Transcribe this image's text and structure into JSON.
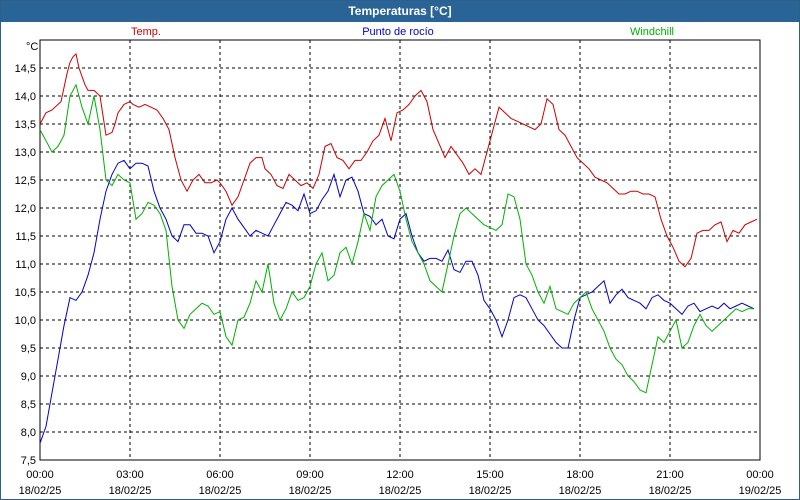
{
  "window": {
    "title": "Temperaturas [°C]"
  },
  "chart_data": {
    "type": "line",
    "title": "Temperaturas [°C]",
    "ylabel": "°C",
    "ylim": [
      7.5,
      15.0
    ],
    "grid": true,
    "legend": "top",
    "y_ticks": [
      "7,5",
      "8,0",
      "8,5",
      "9,0",
      "9,5",
      "10,0",
      "10,5",
      "11,0",
      "11,5",
      "12,0",
      "12,5",
      "13,0",
      "13,5",
      "14,0",
      "14,5"
    ],
    "x_ticks": [
      {
        "time": "00:00",
        "date": "18/02/25"
      },
      {
        "time": "03:00",
        "date": "18/02/25"
      },
      {
        "time": "06:00",
        "date": "18/02/25"
      },
      {
        "time": "09:00",
        "date": "18/02/25"
      },
      {
        "time": "12:00",
        "date": "18/02/25"
      },
      {
        "time": "15:00",
        "date": "18/02/25"
      },
      {
        "time": "18:00",
        "date": "18/02/25"
      },
      {
        "time": "21:00",
        "date": "18/02/25"
      },
      {
        "time": "00:00",
        "date": "19/02/25"
      }
    ],
    "x_range_hours": [
      0,
      24
    ],
    "series": [
      {
        "name": "Temp.",
        "color": "#cc0000",
        "x": [
          0,
          0.2,
          0.4,
          0.7,
          0.9,
          1.0,
          1.1,
          1.2,
          1.3,
          1.4,
          1.5,
          1.6,
          1.8,
          2.0,
          2.2,
          2.4,
          2.5,
          2.6,
          2.8,
          3.0,
          3.1,
          3.3,
          3.5,
          3.7,
          3.9,
          4.1,
          4.3,
          4.5,
          4.7,
          4.9,
          5.1,
          5.3,
          5.5,
          5.7,
          5.9,
          6.0,
          6.2,
          6.4,
          6.6,
          6.8,
          7.0,
          7.2,
          7.4,
          7.5,
          7.7,
          7.9,
          8.1,
          8.3,
          8.5,
          8.7,
          8.9,
          9.1,
          9.3,
          9.5,
          9.7,
          9.9,
          10.1,
          10.3,
          10.5,
          10.7,
          10.9,
          11.1,
          11.3,
          11.5,
          11.7,
          11.9,
          12.1,
          12.3,
          12.5,
          12.7,
          12.9,
          13.1,
          13.3,
          13.5,
          13.7,
          13.9,
          14.1,
          14.3,
          14.5,
          14.7,
          14.9,
          15.1,
          15.3,
          15.5,
          15.7,
          15.9,
          16.1,
          16.3,
          16.5,
          16.7,
          16.9,
          17.1,
          17.3,
          17.5,
          17.7,
          17.9,
          18.1,
          18.3,
          18.5,
          18.7,
          18.9,
          19.1,
          19.3,
          19.5,
          19.7,
          19.9,
          20.1,
          20.3,
          20.5,
          20.7,
          20.9,
          21.1,
          21.3,
          21.5,
          21.7,
          21.9,
          22.1,
          22.3,
          22.5,
          22.7,
          22.9,
          23.1,
          23.3,
          23.5,
          23.7,
          23.9
        ],
        "values": [
          13.5,
          13.7,
          13.75,
          13.9,
          14.4,
          14.6,
          14.7,
          14.75,
          14.5,
          14.35,
          14.2,
          14.1,
          14.1,
          14.0,
          13.3,
          13.35,
          13.5,
          13.7,
          13.85,
          13.9,
          13.85,
          13.8,
          13.85,
          13.8,
          13.75,
          13.6,
          13.4,
          12.9,
          12.5,
          12.3,
          12.5,
          12.6,
          12.45,
          12.45,
          12.5,
          12.45,
          12.3,
          12.05,
          12.2,
          12.5,
          12.8,
          12.9,
          12.9,
          12.7,
          12.6,
          12.4,
          12.35,
          12.6,
          12.5,
          12.4,
          12.45,
          12.35,
          12.6,
          13.1,
          13.15,
          12.9,
          12.85,
          12.7,
          12.85,
          12.85,
          13.0,
          13.2,
          13.3,
          13.6,
          13.2,
          13.7,
          13.75,
          13.85,
          14.0,
          14.1,
          13.9,
          13.4,
          13.15,
          12.9,
          13.1,
          12.95,
          12.8,
          12.6,
          12.7,
          12.6,
          13.0,
          13.4,
          13.8,
          13.7,
          13.6,
          13.55,
          13.5,
          13.45,
          13.4,
          13.5,
          13.95,
          13.85,
          13.4,
          13.3,
          13.1,
          12.9,
          12.8,
          12.7,
          12.55,
          12.5,
          12.45,
          12.35,
          12.25,
          12.25,
          12.3,
          12.3,
          12.25,
          12.25,
          12.2,
          11.8,
          11.5,
          11.3,
          11.05,
          10.95,
          11.1,
          11.55,
          11.6,
          11.6,
          11.7,
          11.75,
          11.4,
          11.6,
          11.55,
          11.7,
          11.75,
          11.8
        ]
      },
      {
        "name": "Punto de rocío",
        "color": "#0000cc",
        "x": [
          0,
          0.2,
          0.4,
          0.6,
          0.8,
          1.0,
          1.2,
          1.4,
          1.6,
          1.8,
          2.0,
          2.2,
          2.4,
          2.6,
          2.8,
          3.0,
          3.2,
          3.4,
          3.6,
          3.8,
          4.0,
          4.2,
          4.4,
          4.6,
          4.8,
          5.0,
          5.2,
          5.4,
          5.6,
          5.8,
          6.0,
          6.2,
          6.4,
          6.6,
          6.8,
          7.0,
          7.2,
          7.4,
          7.6,
          7.8,
          8.0,
          8.2,
          8.4,
          8.6,
          8.8,
          9.0,
          9.2,
          9.4,
          9.6,
          9.8,
          10.0,
          10.2,
          10.4,
          10.6,
          10.8,
          11.0,
          11.2,
          11.4,
          11.6,
          11.8,
          12.0,
          12.2,
          12.4,
          12.6,
          12.8,
          13.0,
          13.2,
          13.4,
          13.6,
          13.8,
          14.0,
          14.2,
          14.4,
          14.6,
          14.8,
          15.0,
          15.2,
          15.4,
          15.6,
          15.8,
          16.0,
          16.2,
          16.4,
          16.6,
          16.8,
          17.0,
          17.2,
          17.4,
          17.6,
          17.8,
          18.0,
          18.2,
          18.4,
          18.6,
          18.8,
          19.0,
          19.2,
          19.4,
          19.6,
          19.8,
          20.0,
          20.2,
          20.4,
          20.6,
          20.8,
          21.0,
          21.2,
          21.4,
          21.6,
          21.8,
          22.0,
          22.2,
          22.4,
          22.6,
          22.8,
          23.0,
          23.2,
          23.4,
          23.6,
          23.8
        ],
        "values": [
          7.8,
          8.1,
          8.7,
          9.3,
          9.9,
          10.4,
          10.35,
          10.5,
          10.8,
          11.2,
          11.8,
          12.3,
          12.6,
          12.8,
          12.85,
          12.7,
          12.8,
          12.8,
          12.75,
          12.3,
          12.0,
          11.8,
          11.5,
          11.4,
          11.7,
          11.7,
          11.55,
          11.55,
          11.5,
          11.2,
          11.4,
          11.8,
          12.0,
          11.8,
          11.65,
          11.5,
          11.6,
          11.55,
          11.5,
          11.7,
          11.9,
          12.1,
          12.05,
          11.95,
          12.25,
          11.9,
          11.95,
          12.15,
          12.3,
          12.6,
          12.2,
          12.5,
          12.55,
          12.3,
          11.9,
          11.85,
          11.7,
          11.8,
          11.5,
          11.45,
          11.8,
          11.9,
          11.5,
          11.2,
          11.05,
          11.1,
          11.1,
          11.05,
          11.25,
          10.9,
          10.85,
          11.05,
          11.05,
          10.8,
          10.35,
          10.2,
          10.0,
          9.7,
          10.0,
          10.4,
          10.45,
          10.4,
          10.2,
          10.0,
          9.9,
          9.75,
          9.6,
          9.5,
          9.5,
          10.0,
          10.4,
          10.45,
          10.5,
          10.6,
          10.7,
          10.3,
          10.45,
          10.55,
          10.4,
          10.35,
          10.3,
          10.2,
          10.4,
          10.45,
          10.35,
          10.3,
          10.2,
          10.1,
          10.25,
          10.3,
          10.15,
          10.2,
          10.25,
          10.2,
          10.3,
          10.2,
          10.25,
          10.3,
          10.25,
          10.2
        ]
      },
      {
        "name": "Windchill",
        "color": "#00b000",
        "x": [
          0,
          0.2,
          0.4,
          0.6,
          0.8,
          1.0,
          1.2,
          1.4,
          1.6,
          1.8,
          2.0,
          2.2,
          2.4,
          2.6,
          2.8,
          3.0,
          3.2,
          3.4,
          3.6,
          3.8,
          4.0,
          4.2,
          4.4,
          4.6,
          4.8,
          5.0,
          5.2,
          5.4,
          5.6,
          5.8,
          6.0,
          6.2,
          6.4,
          6.6,
          6.8,
          7.0,
          7.2,
          7.4,
          7.6,
          7.8,
          8.0,
          8.2,
          8.4,
          8.6,
          8.8,
          9.0,
          9.2,
          9.4,
          9.6,
          9.8,
          10.0,
          10.2,
          10.4,
          10.6,
          10.8,
          11.0,
          11.2,
          11.4,
          11.6,
          11.8,
          12.0,
          12.2,
          12.4,
          12.6,
          12.8,
          13.0,
          13.2,
          13.4,
          13.6,
          13.8,
          14.0,
          14.2,
          14.4,
          14.6,
          14.8,
          15.0,
          15.2,
          15.4,
          15.6,
          15.8,
          16.0,
          16.2,
          16.4,
          16.6,
          16.8,
          17.0,
          17.2,
          17.4,
          17.6,
          17.8,
          18.0,
          18.2,
          18.4,
          18.6,
          18.8,
          19.0,
          19.2,
          19.4,
          19.6,
          19.8,
          20.0,
          20.2,
          20.4,
          20.6,
          20.8,
          21.0,
          21.2,
          21.4,
          21.6,
          21.8,
          22.0,
          22.2,
          22.4,
          22.6,
          22.8,
          23.0,
          23.2,
          23.4,
          23.6,
          23.8
        ],
        "values": [
          13.4,
          13.2,
          13.0,
          13.1,
          13.3,
          14.0,
          14.2,
          13.8,
          13.5,
          14.0,
          13.4,
          12.5,
          12.4,
          12.6,
          12.5,
          12.45,
          11.8,
          11.9,
          12.1,
          12.05,
          11.9,
          11.6,
          10.6,
          10.0,
          9.85,
          10.1,
          10.2,
          10.3,
          10.25,
          10.1,
          10.15,
          9.7,
          9.55,
          10.0,
          10.05,
          10.3,
          10.7,
          10.5,
          11.0,
          10.3,
          10.0,
          10.2,
          10.5,
          10.35,
          10.4,
          10.6,
          11.0,
          11.2,
          10.7,
          10.8,
          11.2,
          11.3,
          11.0,
          11.4,
          11.9,
          11.6,
          12.2,
          12.4,
          12.5,
          12.6,
          12.3,
          11.8,
          11.4,
          11.2,
          11.0,
          10.7,
          10.6,
          10.5,
          11.0,
          11.5,
          11.9,
          12.0,
          11.9,
          11.8,
          11.7,
          11.65,
          11.6,
          11.7,
          12.25,
          12.2,
          11.8,
          11.0,
          10.8,
          10.5,
          10.3,
          10.6,
          10.2,
          10.15,
          10.1,
          10.3,
          10.4,
          10.5,
          10.2,
          10.0,
          9.8,
          9.5,
          9.3,
          9.2,
          9.0,
          8.9,
          8.75,
          8.7,
          9.2,
          9.7,
          9.6,
          9.8,
          10.0,
          9.5,
          9.6,
          9.9,
          10.1,
          9.9,
          9.8,
          9.9,
          10.0,
          10.1,
          10.2,
          10.15,
          10.2,
          10.2
        ]
      }
    ]
  }
}
